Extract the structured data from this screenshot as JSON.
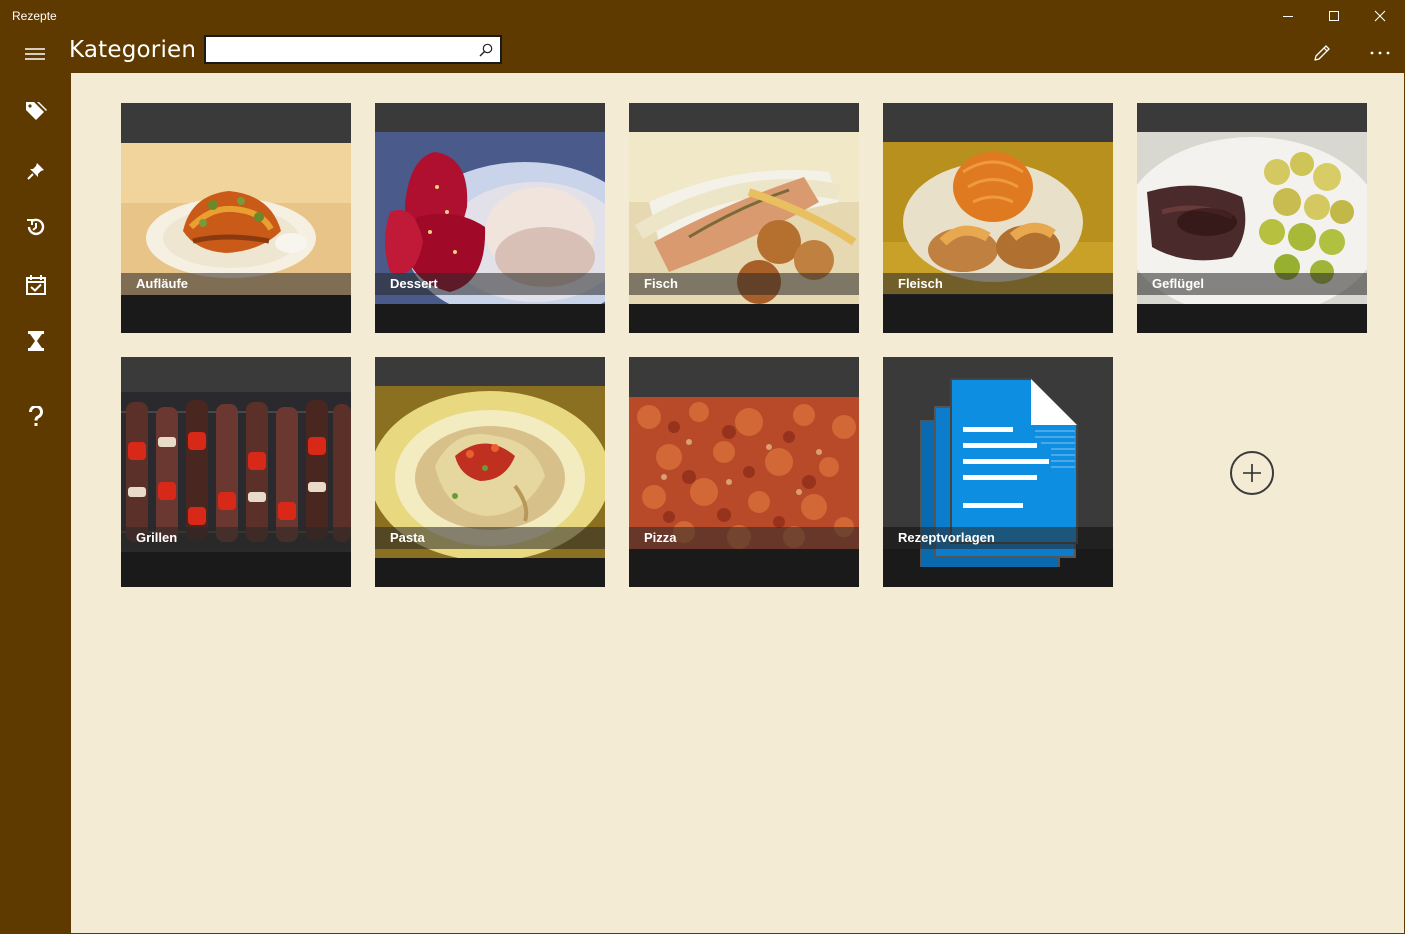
{
  "window": {
    "title": "Rezepte",
    "controls": [
      "minimize",
      "maximize",
      "close"
    ]
  },
  "header": {
    "page_title": "Kategorien",
    "search": {
      "value": "",
      "placeholder": ""
    },
    "commands": [
      "edit-icon",
      "more-icon"
    ]
  },
  "sidebar": {
    "items": [
      {
        "icon": "hamburger-menu-icon"
      },
      {
        "icon": "tags-icon"
      },
      {
        "icon": "pin-icon"
      },
      {
        "icon": "history-icon"
      },
      {
        "icon": "calendar-check-icon"
      },
      {
        "icon": "hourglass-icon"
      },
      {
        "icon": "help-icon"
      }
    ]
  },
  "categories": [
    {
      "label": "Aufläufe"
    },
    {
      "label": "Dessert"
    },
    {
      "label": "Fisch"
    },
    {
      "label": "Fleisch"
    },
    {
      "label": "Geflügel"
    },
    {
      "label": "Grillen"
    },
    {
      "label": "Pasta"
    },
    {
      "label": "Pizza"
    },
    {
      "label": "Rezeptvorlagen"
    }
  ],
  "add_button": {
    "icon": "plus-icon"
  },
  "colors": {
    "chrome": "#5f3a00",
    "content_bg": "#f3ebd3",
    "tile_bg": "#3a3a3a",
    "tile_footer": "#1a1a1a",
    "document_blue": "#0e8ee0"
  }
}
